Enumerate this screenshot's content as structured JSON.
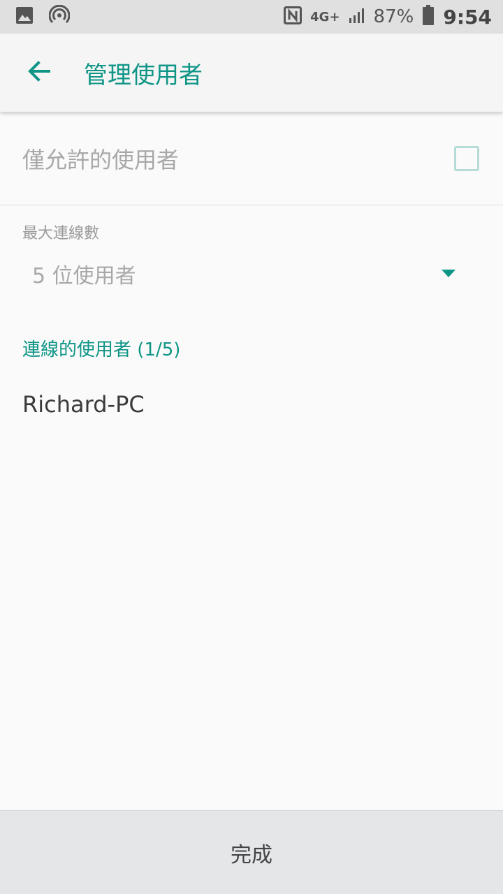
{
  "status_bar": {
    "battery_percent": "87%",
    "time": "9:54",
    "network": "4G+",
    "icons": [
      "image-icon",
      "hotspot-icon",
      "nfc-icon",
      "network-4g-icon",
      "signal-icon",
      "battery-icon"
    ]
  },
  "app_bar": {
    "back_icon": "arrow-back-icon",
    "title": "管理使用者"
  },
  "allow_only": {
    "label": "僅允許的使用者",
    "checked": false
  },
  "max_connections": {
    "label": "最大連線數",
    "value": "5 位使用者"
  },
  "connected_users": {
    "title": "連線的使用者 (1/5)",
    "items": [
      "Richard-PC"
    ]
  },
  "footer": {
    "done_label": "完成"
  },
  "colors": {
    "accent": "#0e9586",
    "status_bar_bg": "#e0e0e0",
    "app_bar_bg": "#f5f5f5",
    "background": "#fafafa",
    "footer_bg": "#e4e6e7"
  }
}
